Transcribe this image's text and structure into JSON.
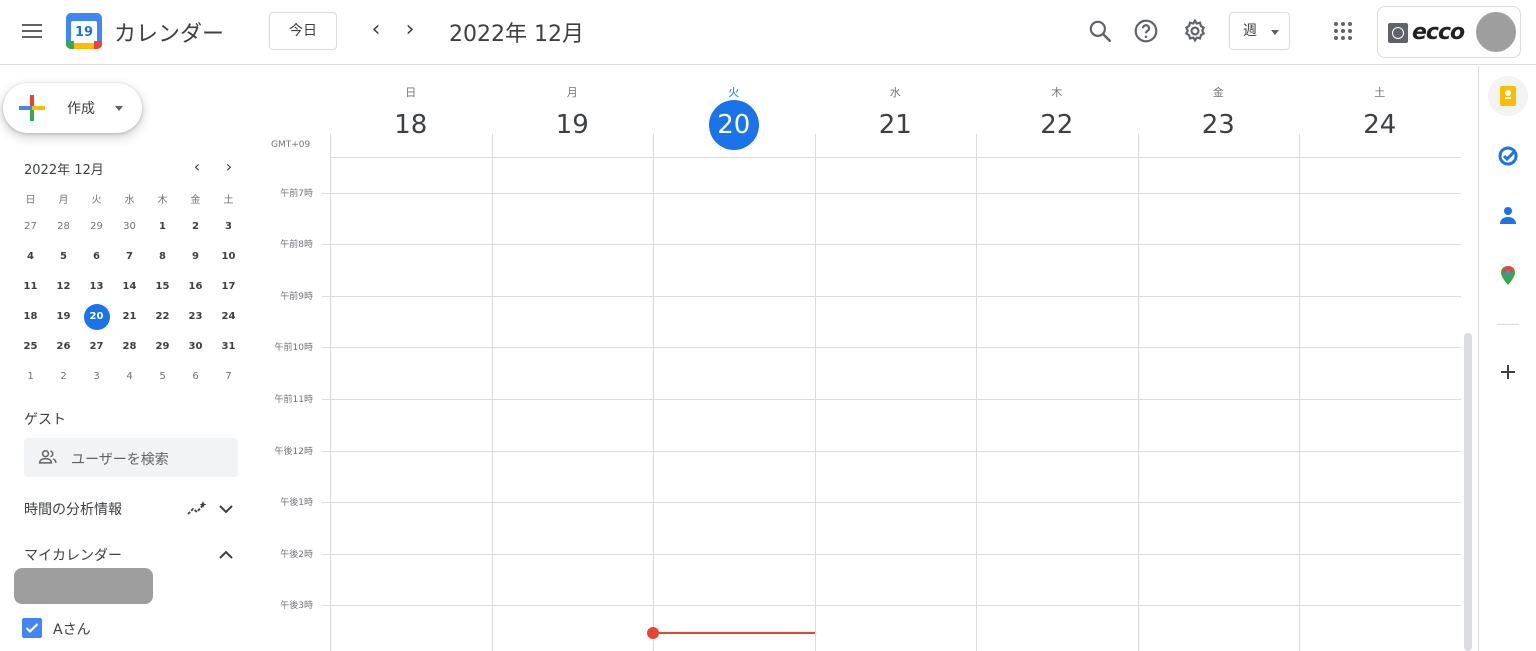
{
  "app": {
    "title": "カレンダー",
    "logo_day": "19"
  },
  "header": {
    "today_button": "今日",
    "prev_arrow": "‹",
    "next_arrow": "›",
    "current_period": "2022年 12月",
    "view_select": "週",
    "account_logo_text": "ecco"
  },
  "sidebar": {
    "create_label": "作成",
    "mini_calendar": {
      "title": "2022年 12月",
      "weekdays": [
        "日",
        "月",
        "火",
        "水",
        "木",
        "金",
        "土"
      ],
      "weeks": [
        [
          "27",
          "28",
          "29",
          "30",
          "1",
          "2",
          "3"
        ],
        [
          "4",
          "5",
          "6",
          "7",
          "8",
          "9",
          "10"
        ],
        [
          "11",
          "12",
          "13",
          "14",
          "15",
          "16",
          "17"
        ],
        [
          "18",
          "19",
          "20",
          "21",
          "22",
          "23",
          "24"
        ],
        [
          "25",
          "26",
          "27",
          "28",
          "29",
          "30",
          "31"
        ],
        [
          "1",
          "2",
          "3",
          "4",
          "5",
          "6",
          "7"
        ]
      ],
      "today": "20"
    },
    "guests_title": "ゲスト",
    "guest_search_placeholder": "ユーザーを検索",
    "time_insights_title": "時間の分析情報",
    "my_calendars_title": "マイカレンダー",
    "calendar_item": "Aさん",
    "calendar_color": "#4285f4"
  },
  "week": {
    "timezone": "GMT+09",
    "days": [
      {
        "dow": "日",
        "num": "18"
      },
      {
        "dow": "月",
        "num": "19"
      },
      {
        "dow": "火",
        "num": "20",
        "today": true
      },
      {
        "dow": "水",
        "num": "21"
      },
      {
        "dow": "木",
        "num": "22"
      },
      {
        "dow": "金",
        "num": "23"
      },
      {
        "dow": "土",
        "num": "24"
      }
    ],
    "hours": [
      "午前7時",
      "午前8時",
      "午前9時",
      "午前10時",
      "午前11時",
      "午後12時",
      "午後1時",
      "午後2時",
      "午後3時"
    ]
  },
  "colors": {
    "accent": "#1a73e8",
    "now_line": "#ea4335",
    "grid": "#dadce0"
  },
  "side_panel": {
    "icons": [
      "keep-icon",
      "tasks-icon",
      "contacts-icon",
      "maps-icon",
      "add-addon-icon"
    ]
  }
}
